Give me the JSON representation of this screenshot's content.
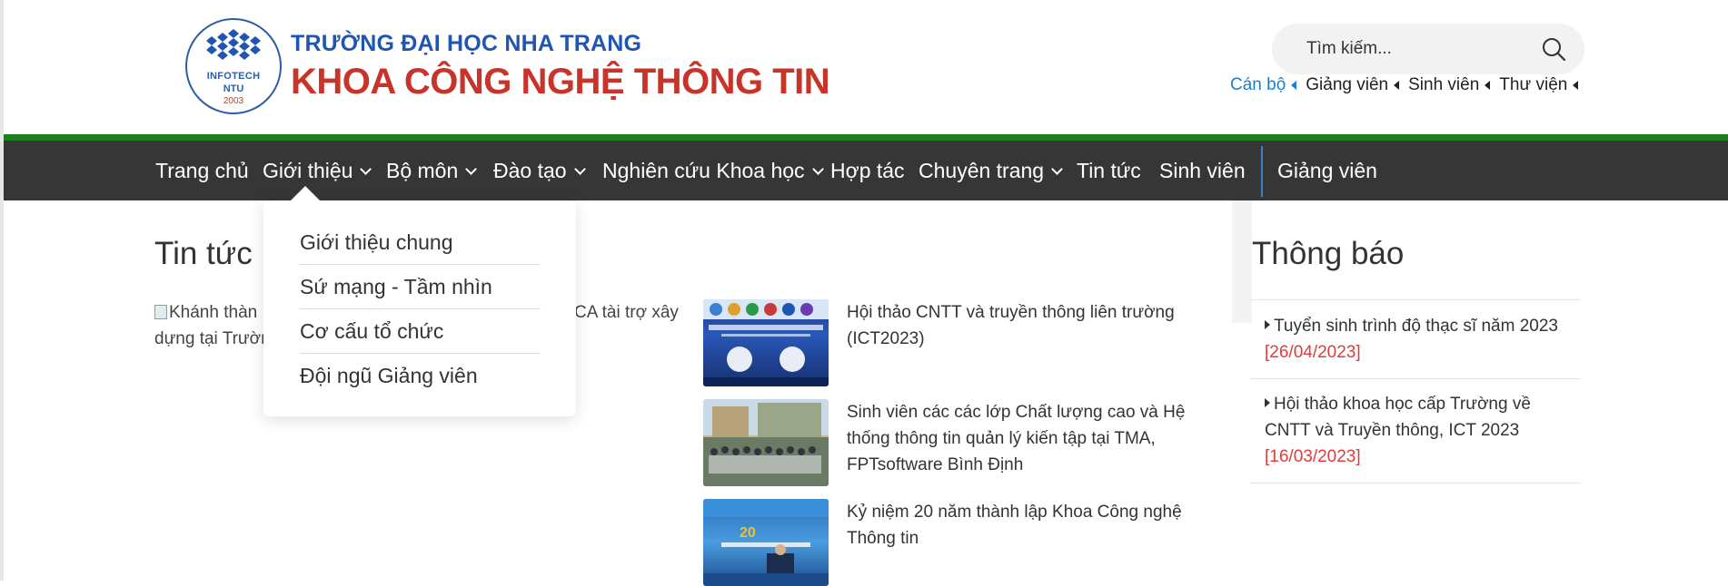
{
  "header": {
    "logo": {
      "line1": "INFOTECH",
      "line2": "NTU",
      "line3": "2003"
    },
    "university": "TRƯỜNG ĐẠI HỌC NHA TRANG",
    "faculty": "KHOA CÔNG NGHỆ THÔNG TIN",
    "search_placeholder": "Tìm kiếm...",
    "quick_links": [
      "Cán bộ",
      "Giảng viên",
      "Sinh viên",
      "Thư viện"
    ],
    "accent_color": "#1a7fd0"
  },
  "nav": {
    "items": [
      {
        "label": "Trang chủ",
        "dropdown": false
      },
      {
        "label": "Giới thiệu",
        "dropdown": true
      },
      {
        "label": "Bộ môn",
        "dropdown": true
      },
      {
        "label": "Đào tạo",
        "dropdown": true
      },
      {
        "label": "Nghiên cứu Khoa học",
        "dropdown": true
      },
      {
        "label": "Hợp tác",
        "dropdown": false
      },
      {
        "label": "Chuyên trang",
        "dropdown": true
      },
      {
        "label": "Tin tức",
        "dropdown": false
      },
      {
        "label": "Sinh viên",
        "dropdown": false
      },
      {
        "label": "Giảng viên",
        "dropdown": false
      }
    ],
    "bar_color": "#363636",
    "stripe_color": "#1e7d1e"
  },
  "dropdown": {
    "items": [
      "Giới thiệu chung",
      "Sứ mạng - Tầm nhìn",
      "Cơ cấu tổ chức",
      "Đội ngũ Giảng viên"
    ]
  },
  "news": {
    "title": "Tin tức",
    "featured_alt_line1": "Khánh thàn",
    "featured_alt_line1_end": "CA tài trợ xây",
    "featured_alt_line2": "dựng tại Trườn",
    "items": [
      {
        "title": "Hội thảo CNTT và truyền thông liên trường (ICT2023)"
      },
      {
        "title": "Sinh viên các các lớp Chất lượng cao và Hệ thống thông tin quản lý kiến tập tại TMA, FPTsoftware Bình Định"
      },
      {
        "title": "Kỷ niệm 20 năm thành lập Khoa Công nghệ Thông tin"
      }
    ]
  },
  "notices": {
    "title": "Thông báo",
    "items": [
      {
        "title": "Tuyển sinh trình độ thạc sĩ năm 2023",
        "date": "[26/04/2023]"
      },
      {
        "title": "Hội thảo khoa học cấp Trường về CNTT và Truyền thông, ICT 2023",
        "date": "[16/03/2023]"
      }
    ],
    "date_color": "#e03c3c"
  }
}
